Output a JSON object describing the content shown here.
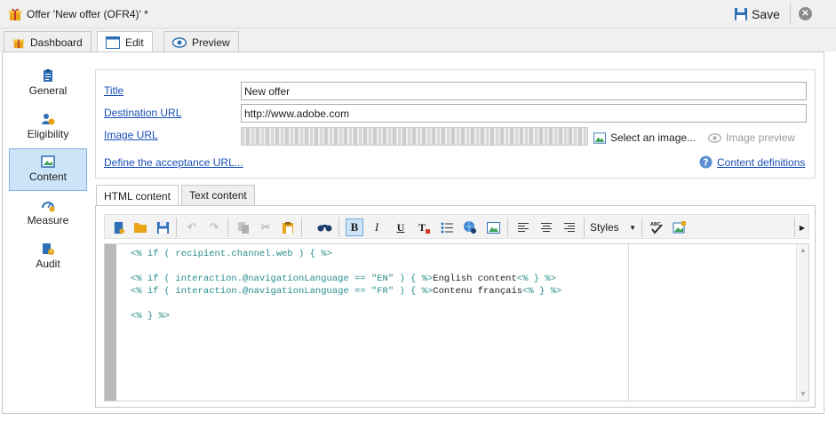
{
  "window": {
    "title": "Offer 'New offer (OFR4)' *",
    "save_label": "Save",
    "close_glyph": "✕"
  },
  "main_tabs": [
    {
      "label": "Dashboard",
      "icon": "gift-icon"
    },
    {
      "label": "Edit",
      "icon": "form-icon",
      "active": true
    },
    {
      "label": "Preview",
      "icon": "eye-icon"
    }
  ],
  "nav": [
    {
      "label": "General",
      "icon": "clipboard-icon"
    },
    {
      "label": "Eligibility",
      "icon": "users-icon"
    },
    {
      "label": "Content",
      "icon": "image-icon",
      "active": true
    },
    {
      "label": "Measure",
      "icon": "gauge-icon"
    },
    {
      "label": "Audit",
      "icon": "audit-icon"
    }
  ],
  "form": {
    "title_label": "Title",
    "title_value": "New offer",
    "destination_label": "Destination URL",
    "destination_value": "http://www.adobe.com",
    "image_label": "Image URL",
    "select_image": "Select an image...",
    "image_preview": "Image preview",
    "acceptance_link": "Define the acceptance URL...",
    "content_definitions": "Content definitions"
  },
  "content_tabs": [
    {
      "label": "HTML content",
      "active": true
    },
    {
      "label": "Text content"
    }
  ],
  "toolbar": {
    "styles_label": "Styles",
    "buttons": [
      "new-doc-icon",
      "open-folder-icon",
      "save-disk-icon",
      "undo-icon",
      "redo-icon",
      "copy-icon",
      "cut-icon",
      "paste-icon",
      "find-icon",
      "bold-icon",
      "italic-icon",
      "underline-icon",
      "clear-format-icon",
      "bullet-list-icon",
      "link-icon",
      "insert-image-icon",
      "align-left-icon",
      "align-center-icon",
      "align-right-icon",
      "spellcheck-icon",
      "personalize-icon",
      "more-icon"
    ]
  },
  "code": {
    "line1": "<% if ( recipient.channel.web ) { %>",
    "line2_tag1": "<% if ( interaction.@navigationLanguage == \"EN\" ) { %>",
    "line2_text": "English content",
    "line2_tag2": "<% } %>",
    "line3_tag1": "<% if ( interaction.@navigationLanguage == \"FR\" ) { %>",
    "line3_text": "Contenu français",
    "line3_tag2": "<% } %>",
    "line4": "<% } %>"
  },
  "colors": {
    "accent": "#1a4fb8",
    "nav_active_bg": "#cce4f7",
    "code_tag": "#2a8c8c"
  }
}
